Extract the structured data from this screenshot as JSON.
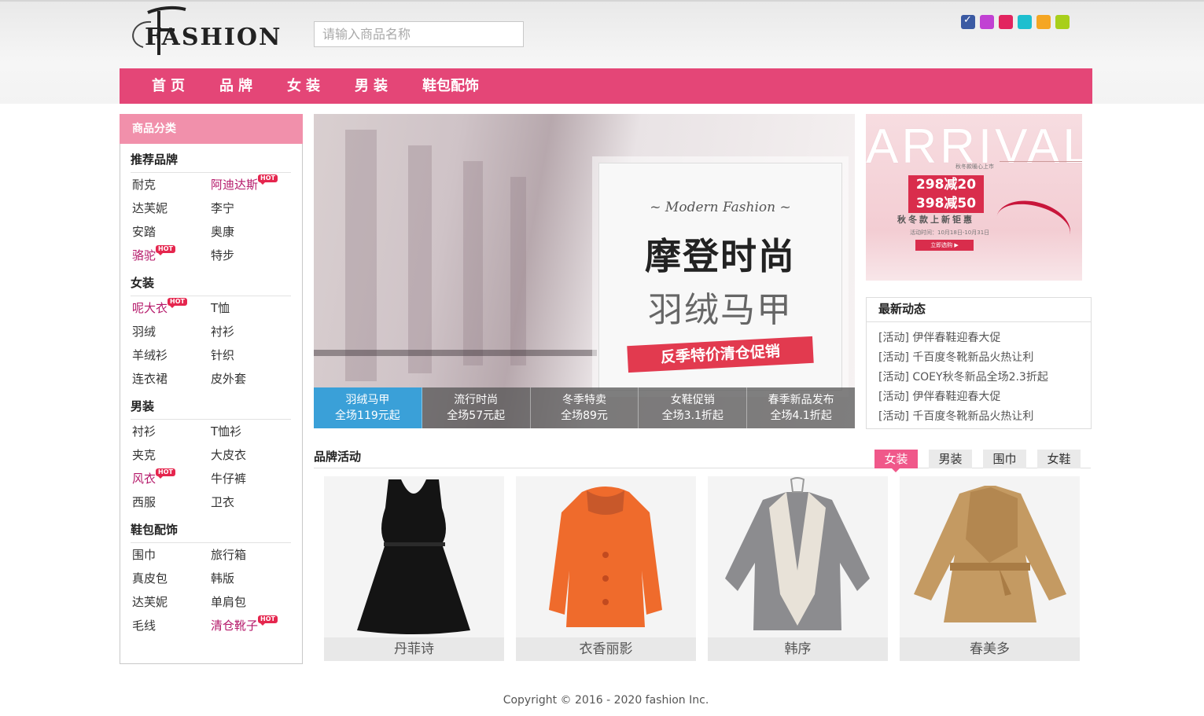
{
  "header": {
    "logo_text": "FASHION",
    "search_placeholder": "请输入商品名称",
    "theme_colors": [
      "#3b5aa3",
      "#c141d3",
      "#e2245f",
      "#1dbfcf",
      "#f5a623",
      "#a8cf1b"
    ]
  },
  "nav": {
    "items": [
      "首页",
      "品牌",
      "女装",
      "男装",
      "鞋包配饰"
    ]
  },
  "sidebar": {
    "title": "商品分类",
    "hot_label": "HOT",
    "categories": [
      {
        "title": "推荐品牌",
        "items": [
          {
            "label": "耐克",
            "hot": false
          },
          {
            "label": "阿迪达斯",
            "hot": true
          },
          {
            "label": "达芙妮",
            "hot": false
          },
          {
            "label": "李宁",
            "hot": false
          },
          {
            "label": "安踏",
            "hot": false
          },
          {
            "label": "奥康",
            "hot": false
          },
          {
            "label": "骆驼",
            "hot": true
          },
          {
            "label": "特步",
            "hot": false
          }
        ]
      },
      {
        "title": "女装",
        "items": [
          {
            "label": "呢大衣",
            "hot": true
          },
          {
            "label": "T恤",
            "hot": false
          },
          {
            "label": "羽绒",
            "hot": false
          },
          {
            "label": "衬衫",
            "hot": false
          },
          {
            "label": "羊绒衫",
            "hot": false
          },
          {
            "label": "针织",
            "hot": false
          },
          {
            "label": "连衣裙",
            "hot": false
          },
          {
            "label": "皮外套",
            "hot": false
          }
        ]
      },
      {
        "title": "男装",
        "items": [
          {
            "label": "衬衫",
            "hot": false
          },
          {
            "label": "T恤衫",
            "hot": false
          },
          {
            "label": "夹克",
            "hot": false
          },
          {
            "label": "大皮衣",
            "hot": false
          },
          {
            "label": "风衣",
            "hot": true
          },
          {
            "label": "牛仔裤",
            "hot": false
          },
          {
            "label": "西服",
            "hot": false
          },
          {
            "label": "卫衣",
            "hot": false
          }
        ]
      },
      {
        "title": "鞋包配饰",
        "items": [
          {
            "label": "围巾",
            "hot": false
          },
          {
            "label": "旅行箱",
            "hot": false
          },
          {
            "label": "真皮包",
            "hot": false
          },
          {
            "label": "韩版",
            "hot": false
          },
          {
            "label": "达芙妮",
            "hot": false
          },
          {
            "label": "单肩包",
            "hot": false
          },
          {
            "label": "毛线",
            "hot": false
          },
          {
            "label": "清仓靴子",
            "hot": true
          }
        ]
      }
    ]
  },
  "banner": {
    "subtitle": "~ Modern Fashion ~",
    "title": "摩登时尚",
    "title2": "羽绒马甲",
    "ribbon": "反季特价清仓促销",
    "tabs": [
      {
        "line1": "羽绒马甲",
        "line2": "全场119元起",
        "active": true
      },
      {
        "line1": "流行时尚",
        "line2": "全场57元起",
        "active": false
      },
      {
        "line1": "冬季特卖",
        "line2": "全场89元",
        "active": false
      },
      {
        "line1": "女鞋促销",
        "line2": "全场3.1折起",
        "active": false
      },
      {
        "line1": "春季新品发布",
        "line2": "全场4.1折起",
        "active": false
      }
    ]
  },
  "ad": {
    "title": "ARRIVAL",
    "small": "秋冬款暖心上市",
    "price1": "298减20",
    "price2": "398减50",
    "caption": "秋冬款上新钜惠",
    "date": "活动时间：10月18日-10月31日",
    "button": "立即选购 ▶"
  },
  "news": {
    "title": "最新动态",
    "items": [
      "[活动] 伊伴春鞋迎春大促",
      "[活动] 千百度冬靴新品火热让利",
      "[活动] COEY秋冬新品全场2.3折起",
      "[活动] 伊伴春鞋迎春大促",
      "[活动] 千百度冬靴新品火热让利"
    ]
  },
  "brand": {
    "title": "品牌活动",
    "tabs": [
      {
        "label": "女装",
        "active": true
      },
      {
        "label": "男装",
        "active": false
      },
      {
        "label": "围巾",
        "active": false
      },
      {
        "label": "女鞋",
        "active": false
      }
    ],
    "products": [
      {
        "name": "丹菲诗",
        "icon": "black-dress"
      },
      {
        "name": "衣香丽影",
        "icon": "orange-coat"
      },
      {
        "name": "韩序",
        "icon": "grey-coat"
      },
      {
        "name": "春美多",
        "icon": "camel-coat"
      }
    ]
  },
  "footer": {
    "copyright": "Copyright © 2016 - 2020 fashion Inc."
  }
}
